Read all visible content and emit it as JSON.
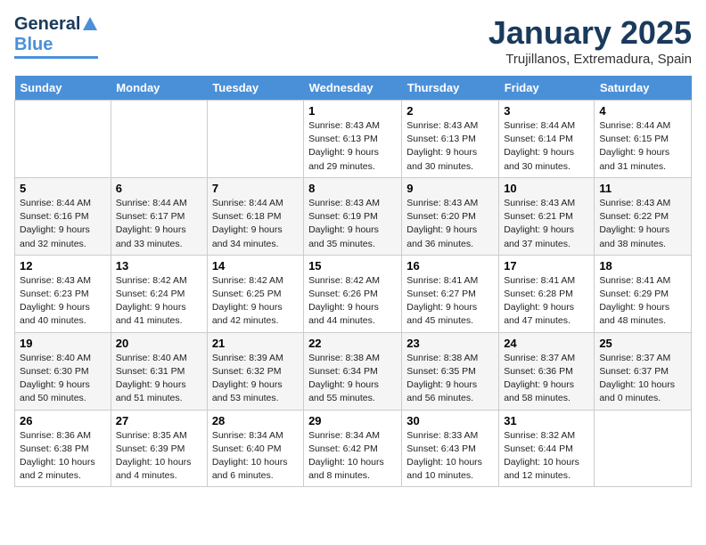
{
  "header": {
    "logo": {
      "general": "General",
      "blue": "Blue"
    },
    "title": "January 2025",
    "location": "Trujillanos, Extremadura, Spain"
  },
  "calendar": {
    "days_of_week": [
      "Sunday",
      "Monday",
      "Tuesday",
      "Wednesday",
      "Thursday",
      "Friday",
      "Saturday"
    ],
    "weeks": [
      [
        {
          "day": "",
          "info": ""
        },
        {
          "day": "",
          "info": ""
        },
        {
          "day": "",
          "info": ""
        },
        {
          "day": "1",
          "info": "Sunrise: 8:43 AM\nSunset: 6:13 PM\nDaylight: 9 hours\nand 29 minutes."
        },
        {
          "day": "2",
          "info": "Sunrise: 8:43 AM\nSunset: 6:13 PM\nDaylight: 9 hours\nand 30 minutes."
        },
        {
          "day": "3",
          "info": "Sunrise: 8:44 AM\nSunset: 6:14 PM\nDaylight: 9 hours\nand 30 minutes."
        },
        {
          "day": "4",
          "info": "Sunrise: 8:44 AM\nSunset: 6:15 PM\nDaylight: 9 hours\nand 31 minutes."
        }
      ],
      [
        {
          "day": "5",
          "info": "Sunrise: 8:44 AM\nSunset: 6:16 PM\nDaylight: 9 hours\nand 32 minutes."
        },
        {
          "day": "6",
          "info": "Sunrise: 8:44 AM\nSunset: 6:17 PM\nDaylight: 9 hours\nand 33 minutes."
        },
        {
          "day": "7",
          "info": "Sunrise: 8:44 AM\nSunset: 6:18 PM\nDaylight: 9 hours\nand 34 minutes."
        },
        {
          "day": "8",
          "info": "Sunrise: 8:43 AM\nSunset: 6:19 PM\nDaylight: 9 hours\nand 35 minutes."
        },
        {
          "day": "9",
          "info": "Sunrise: 8:43 AM\nSunset: 6:20 PM\nDaylight: 9 hours\nand 36 minutes."
        },
        {
          "day": "10",
          "info": "Sunrise: 8:43 AM\nSunset: 6:21 PM\nDaylight: 9 hours\nand 37 minutes."
        },
        {
          "day": "11",
          "info": "Sunrise: 8:43 AM\nSunset: 6:22 PM\nDaylight: 9 hours\nand 38 minutes."
        }
      ],
      [
        {
          "day": "12",
          "info": "Sunrise: 8:43 AM\nSunset: 6:23 PM\nDaylight: 9 hours\nand 40 minutes."
        },
        {
          "day": "13",
          "info": "Sunrise: 8:42 AM\nSunset: 6:24 PM\nDaylight: 9 hours\nand 41 minutes."
        },
        {
          "day": "14",
          "info": "Sunrise: 8:42 AM\nSunset: 6:25 PM\nDaylight: 9 hours\nand 42 minutes."
        },
        {
          "day": "15",
          "info": "Sunrise: 8:42 AM\nSunset: 6:26 PM\nDaylight: 9 hours\nand 44 minutes."
        },
        {
          "day": "16",
          "info": "Sunrise: 8:41 AM\nSunset: 6:27 PM\nDaylight: 9 hours\nand 45 minutes."
        },
        {
          "day": "17",
          "info": "Sunrise: 8:41 AM\nSunset: 6:28 PM\nDaylight: 9 hours\nand 47 minutes."
        },
        {
          "day": "18",
          "info": "Sunrise: 8:41 AM\nSunset: 6:29 PM\nDaylight: 9 hours\nand 48 minutes."
        }
      ],
      [
        {
          "day": "19",
          "info": "Sunrise: 8:40 AM\nSunset: 6:30 PM\nDaylight: 9 hours\nand 50 minutes."
        },
        {
          "day": "20",
          "info": "Sunrise: 8:40 AM\nSunset: 6:31 PM\nDaylight: 9 hours\nand 51 minutes."
        },
        {
          "day": "21",
          "info": "Sunrise: 8:39 AM\nSunset: 6:32 PM\nDaylight: 9 hours\nand 53 minutes."
        },
        {
          "day": "22",
          "info": "Sunrise: 8:38 AM\nSunset: 6:34 PM\nDaylight: 9 hours\nand 55 minutes."
        },
        {
          "day": "23",
          "info": "Sunrise: 8:38 AM\nSunset: 6:35 PM\nDaylight: 9 hours\nand 56 minutes."
        },
        {
          "day": "24",
          "info": "Sunrise: 8:37 AM\nSunset: 6:36 PM\nDaylight: 9 hours\nand 58 minutes."
        },
        {
          "day": "25",
          "info": "Sunrise: 8:37 AM\nSunset: 6:37 PM\nDaylight: 10 hours\nand 0 minutes."
        }
      ],
      [
        {
          "day": "26",
          "info": "Sunrise: 8:36 AM\nSunset: 6:38 PM\nDaylight: 10 hours\nand 2 minutes."
        },
        {
          "day": "27",
          "info": "Sunrise: 8:35 AM\nSunset: 6:39 PM\nDaylight: 10 hours\nand 4 minutes."
        },
        {
          "day": "28",
          "info": "Sunrise: 8:34 AM\nSunset: 6:40 PM\nDaylight: 10 hours\nand 6 minutes."
        },
        {
          "day": "29",
          "info": "Sunrise: 8:34 AM\nSunset: 6:42 PM\nDaylight: 10 hours\nand 8 minutes."
        },
        {
          "day": "30",
          "info": "Sunrise: 8:33 AM\nSunset: 6:43 PM\nDaylight: 10 hours\nand 10 minutes."
        },
        {
          "day": "31",
          "info": "Sunrise: 8:32 AM\nSunset: 6:44 PM\nDaylight: 10 hours\nand 12 minutes."
        },
        {
          "day": "",
          "info": ""
        }
      ]
    ]
  }
}
